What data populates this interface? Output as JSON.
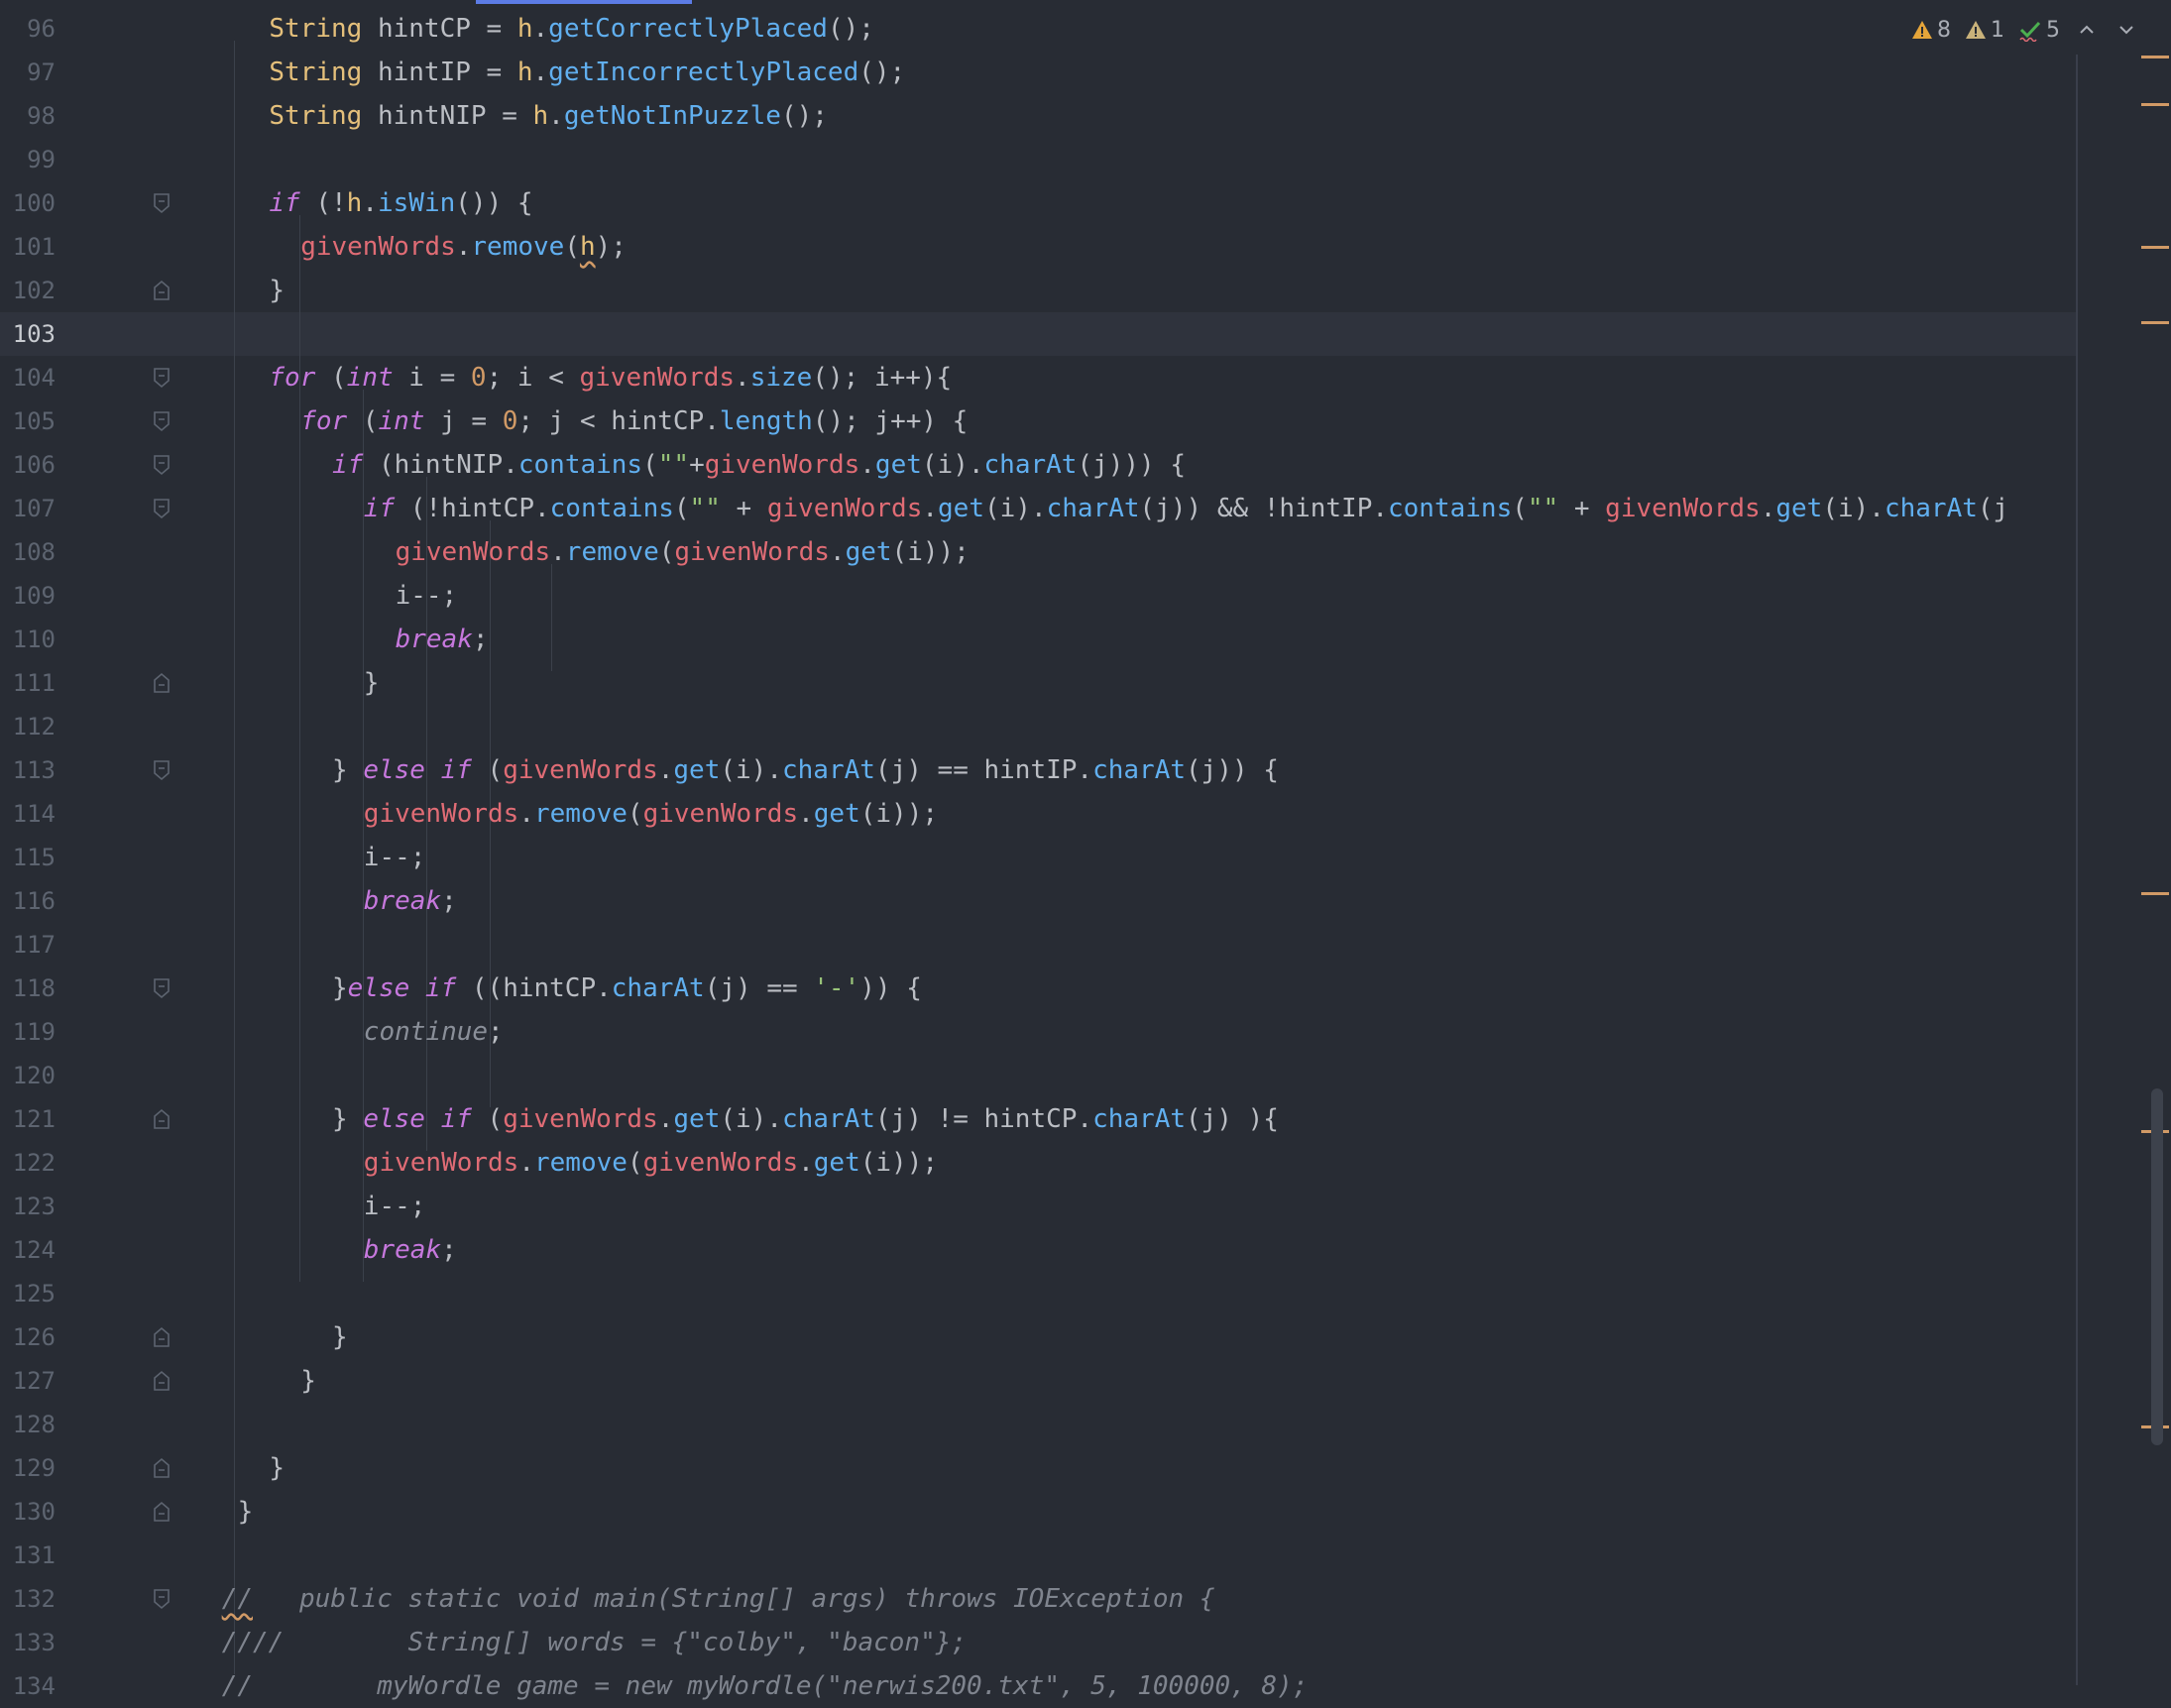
{
  "inspections": {
    "warnings": "8",
    "weak_warnings": "1",
    "typos": "5"
  },
  "colors": {
    "background": "#282c34",
    "keyword": "#c678dd",
    "type": "#e5c07b",
    "field": "#e06c75",
    "method": "#61afef",
    "number": "#d19a66",
    "string": "#98c379",
    "comment": "#7f848e"
  },
  "current_line": "103",
  "lines": [
    {
      "num": "96",
      "indent": 6,
      "tokens": [
        [
          "type",
          "String"
        ],
        [
          "var",
          " hintCP = "
        ],
        [
          "type",
          "h"
        ],
        [
          "op",
          "."
        ],
        [
          "fn",
          "getCorrectlyPlaced"
        ],
        [
          "op",
          "();"
        ]
      ]
    },
    {
      "num": "97",
      "indent": 6,
      "tokens": [
        [
          "type",
          "String"
        ],
        [
          "var",
          " hintIP = "
        ],
        [
          "type",
          "h"
        ],
        [
          "op",
          "."
        ],
        [
          "fn",
          "getIncorrectlyPlaced"
        ],
        [
          "op",
          "();"
        ]
      ]
    },
    {
      "num": "98",
      "indent": 6,
      "tokens": [
        [
          "type",
          "String"
        ],
        [
          "var",
          " hintNIP = "
        ],
        [
          "type",
          "h"
        ],
        [
          "op",
          "."
        ],
        [
          "fn",
          "getNotInPuzzle"
        ],
        [
          "op",
          "();"
        ]
      ]
    },
    {
      "num": "99",
      "indent": 0,
      "tokens": []
    },
    {
      "num": "100",
      "indent": 6,
      "fold": "open",
      "tokens": [
        [
          "kw",
          "if"
        ],
        [
          "op",
          " (!"
        ],
        [
          "type",
          "h"
        ],
        [
          "op",
          "."
        ],
        [
          "fn",
          "isWin"
        ],
        [
          "op",
          "()) {"
        ]
      ]
    },
    {
      "num": "101",
      "indent": 8,
      "tokens": [
        [
          "field",
          "givenWords"
        ],
        [
          "op",
          "."
        ],
        [
          "fn",
          "remove"
        ],
        [
          "op",
          "("
        ],
        [
          "wtype",
          "h"
        ],
        [
          "op",
          ");"
        ]
      ]
    },
    {
      "num": "102",
      "indent": 6,
      "fold": "close",
      "tokens": [
        [
          "op",
          "}"
        ]
      ]
    },
    {
      "num": "103",
      "indent": 0,
      "tokens": []
    },
    {
      "num": "104",
      "indent": 6,
      "fold": "open",
      "tokens": [
        [
          "kw",
          "for"
        ],
        [
          "op",
          " ("
        ],
        [
          "kw",
          "int"
        ],
        [
          "var",
          " i = "
        ],
        [
          "num",
          "0"
        ],
        [
          "var",
          "; i < "
        ],
        [
          "field",
          "givenWords"
        ],
        [
          "op",
          "."
        ],
        [
          "fn",
          "size"
        ],
        [
          "op",
          "(); i++){"
        ]
      ]
    },
    {
      "num": "105",
      "indent": 8,
      "fold": "open",
      "tokens": [
        [
          "kw",
          "for"
        ],
        [
          "op",
          " ("
        ],
        [
          "kw",
          "int"
        ],
        [
          "var",
          " j = "
        ],
        [
          "num",
          "0"
        ],
        [
          "var",
          "; j < hintCP."
        ],
        [
          "fn",
          "length"
        ],
        [
          "op",
          "(); j++) {"
        ]
      ]
    },
    {
      "num": "106",
      "indent": 10,
      "fold": "open",
      "tokens": [
        [
          "kw",
          "if"
        ],
        [
          "var",
          " (hintNIP."
        ],
        [
          "fn",
          "contains"
        ],
        [
          "op",
          "("
        ],
        [
          "str",
          "\"\""
        ],
        [
          "op",
          "+"
        ],
        [
          "field",
          "givenWords"
        ],
        [
          "op",
          "."
        ],
        [
          "fn",
          "get"
        ],
        [
          "op",
          "(i)."
        ],
        [
          "fn",
          "charAt"
        ],
        [
          "op",
          "(j))) {"
        ]
      ]
    },
    {
      "num": "107",
      "indent": 12,
      "fold": "open",
      "tokens": [
        [
          "kw",
          "if"
        ],
        [
          "var",
          " (!hintCP."
        ],
        [
          "fn",
          "contains"
        ],
        [
          "op",
          "("
        ],
        [
          "str",
          "\"\""
        ],
        [
          "op",
          " + "
        ],
        [
          "field",
          "givenWords"
        ],
        [
          "op",
          "."
        ],
        [
          "fn",
          "get"
        ],
        [
          "op",
          "(i)."
        ],
        [
          "fn",
          "charAt"
        ],
        [
          "op",
          "(j)) && !hintIP."
        ],
        [
          "fn",
          "contains"
        ],
        [
          "op",
          "("
        ],
        [
          "str",
          "\"\""
        ],
        [
          "op",
          " + "
        ],
        [
          "field",
          "givenWords"
        ],
        [
          "op",
          "."
        ],
        [
          "fn",
          "get"
        ],
        [
          "op",
          "(i)."
        ],
        [
          "fn",
          "charAt"
        ],
        [
          "op",
          "(j"
        ]
      ]
    },
    {
      "num": "108",
      "indent": 14,
      "tokens": [
        [
          "field",
          "givenWords"
        ],
        [
          "op",
          "."
        ],
        [
          "fn",
          "remove"
        ],
        [
          "op",
          "("
        ],
        [
          "field",
          "givenWords"
        ],
        [
          "op",
          "."
        ],
        [
          "fn",
          "get"
        ],
        [
          "op",
          "(i));"
        ]
      ]
    },
    {
      "num": "109",
      "indent": 14,
      "tokens": [
        [
          "var",
          "i--;"
        ]
      ]
    },
    {
      "num": "110",
      "indent": 14,
      "tokens": [
        [
          "kw",
          "break"
        ],
        [
          "op",
          ";"
        ]
      ]
    },
    {
      "num": "111",
      "indent": 12,
      "fold": "close",
      "tokens": [
        [
          "op",
          "}"
        ]
      ]
    },
    {
      "num": "112",
      "indent": 0,
      "tokens": []
    },
    {
      "num": "113",
      "indent": 10,
      "fold": "open",
      "tokens": [
        [
          "op",
          "} "
        ],
        [
          "kw",
          "else if"
        ],
        [
          "op",
          " ("
        ],
        [
          "field",
          "givenWords"
        ],
        [
          "op",
          "."
        ],
        [
          "fn",
          "get"
        ],
        [
          "op",
          "(i)."
        ],
        [
          "fn",
          "charAt"
        ],
        [
          "op",
          "(j) == hintIP."
        ],
        [
          "fn",
          "charAt"
        ],
        [
          "op",
          "(j)) {"
        ]
      ]
    },
    {
      "num": "114",
      "indent": 12,
      "tokens": [
        [
          "field",
          "givenWords"
        ],
        [
          "op",
          "."
        ],
        [
          "fn",
          "remove"
        ],
        [
          "op",
          "("
        ],
        [
          "field",
          "givenWords"
        ],
        [
          "op",
          "."
        ],
        [
          "fn",
          "get"
        ],
        [
          "op",
          "(i));"
        ]
      ]
    },
    {
      "num": "115",
      "indent": 12,
      "tokens": [
        [
          "var",
          "i--;"
        ]
      ]
    },
    {
      "num": "116",
      "indent": 12,
      "tokens": [
        [
          "kw",
          "break"
        ],
        [
          "op",
          ";"
        ]
      ]
    },
    {
      "num": "117",
      "indent": 0,
      "tokens": []
    },
    {
      "num": "118",
      "indent": 10,
      "fold": "open",
      "tokens": [
        [
          "op",
          "}"
        ],
        [
          "kw",
          "else if"
        ],
        [
          "op",
          " ((hintCP."
        ],
        [
          "fn",
          "charAt"
        ],
        [
          "op",
          "(j) == "
        ],
        [
          "str",
          "'-'"
        ],
        [
          "op",
          ")) {"
        ]
      ]
    },
    {
      "num": "119",
      "indent": 12,
      "tokens": [
        [
          "kwgray",
          "continue"
        ],
        [
          "op",
          ";"
        ]
      ]
    },
    {
      "num": "120",
      "indent": 0,
      "tokens": []
    },
    {
      "num": "121",
      "indent": 10,
      "fold": "close",
      "tokens": [
        [
          "op",
          "} "
        ],
        [
          "kw",
          "else if"
        ],
        [
          "op",
          " ("
        ],
        [
          "field",
          "givenWords"
        ],
        [
          "op",
          "."
        ],
        [
          "fn",
          "get"
        ],
        [
          "op",
          "(i)."
        ],
        [
          "fn",
          "charAt"
        ],
        [
          "op",
          "(j) != hintCP."
        ],
        [
          "fn",
          "charAt"
        ],
        [
          "op",
          "(j) ){"
        ]
      ]
    },
    {
      "num": "122",
      "indent": 12,
      "tokens": [
        [
          "field",
          "givenWords"
        ],
        [
          "op",
          "."
        ],
        [
          "fn",
          "remove"
        ],
        [
          "op",
          "("
        ],
        [
          "field",
          "givenWords"
        ],
        [
          "op",
          "."
        ],
        [
          "fn",
          "get"
        ],
        [
          "op",
          "(i));"
        ]
      ]
    },
    {
      "num": "123",
      "indent": 12,
      "tokens": [
        [
          "var",
          "i--;"
        ]
      ]
    },
    {
      "num": "124",
      "indent": 12,
      "tokens": [
        [
          "kw",
          "break"
        ],
        [
          "op",
          ";"
        ]
      ]
    },
    {
      "num": "125",
      "indent": 0,
      "tokens": []
    },
    {
      "num": "126",
      "indent": 10,
      "fold": "close",
      "tokens": [
        [
          "op",
          "}"
        ]
      ]
    },
    {
      "num": "127",
      "indent": 8,
      "fold": "close",
      "tokens": [
        [
          "op",
          "}"
        ]
      ]
    },
    {
      "num": "128",
      "indent": 0,
      "tokens": []
    },
    {
      "num": "129",
      "indent": 6,
      "fold": "close",
      "tokens": [
        [
          "op",
          "}"
        ]
      ]
    },
    {
      "num": "130",
      "indent": 4,
      "fold": "close",
      "tokens": [
        [
          "op",
          "}"
        ]
      ]
    },
    {
      "num": "131",
      "indent": 0,
      "tokens": []
    },
    {
      "num": "132",
      "indent": 3,
      "fold": "open",
      "tokens": [
        [
          "wcmt",
          "//"
        ],
        [
          "cmt",
          "   public static void main(String[] args) throws IOException {"
        ]
      ]
    },
    {
      "num": "133",
      "indent": 3,
      "tokens": [
        [
          "cmt",
          "////        String[] words = {\"colby\", \"bacon\"};"
        ]
      ]
    },
    {
      "num": "134",
      "indent": 3,
      "tokens": [
        [
          "cmt",
          "//        myWordle game = new myWordle(\"nerwis200.txt\", 5, 100000, 8);"
        ]
      ]
    }
  ]
}
